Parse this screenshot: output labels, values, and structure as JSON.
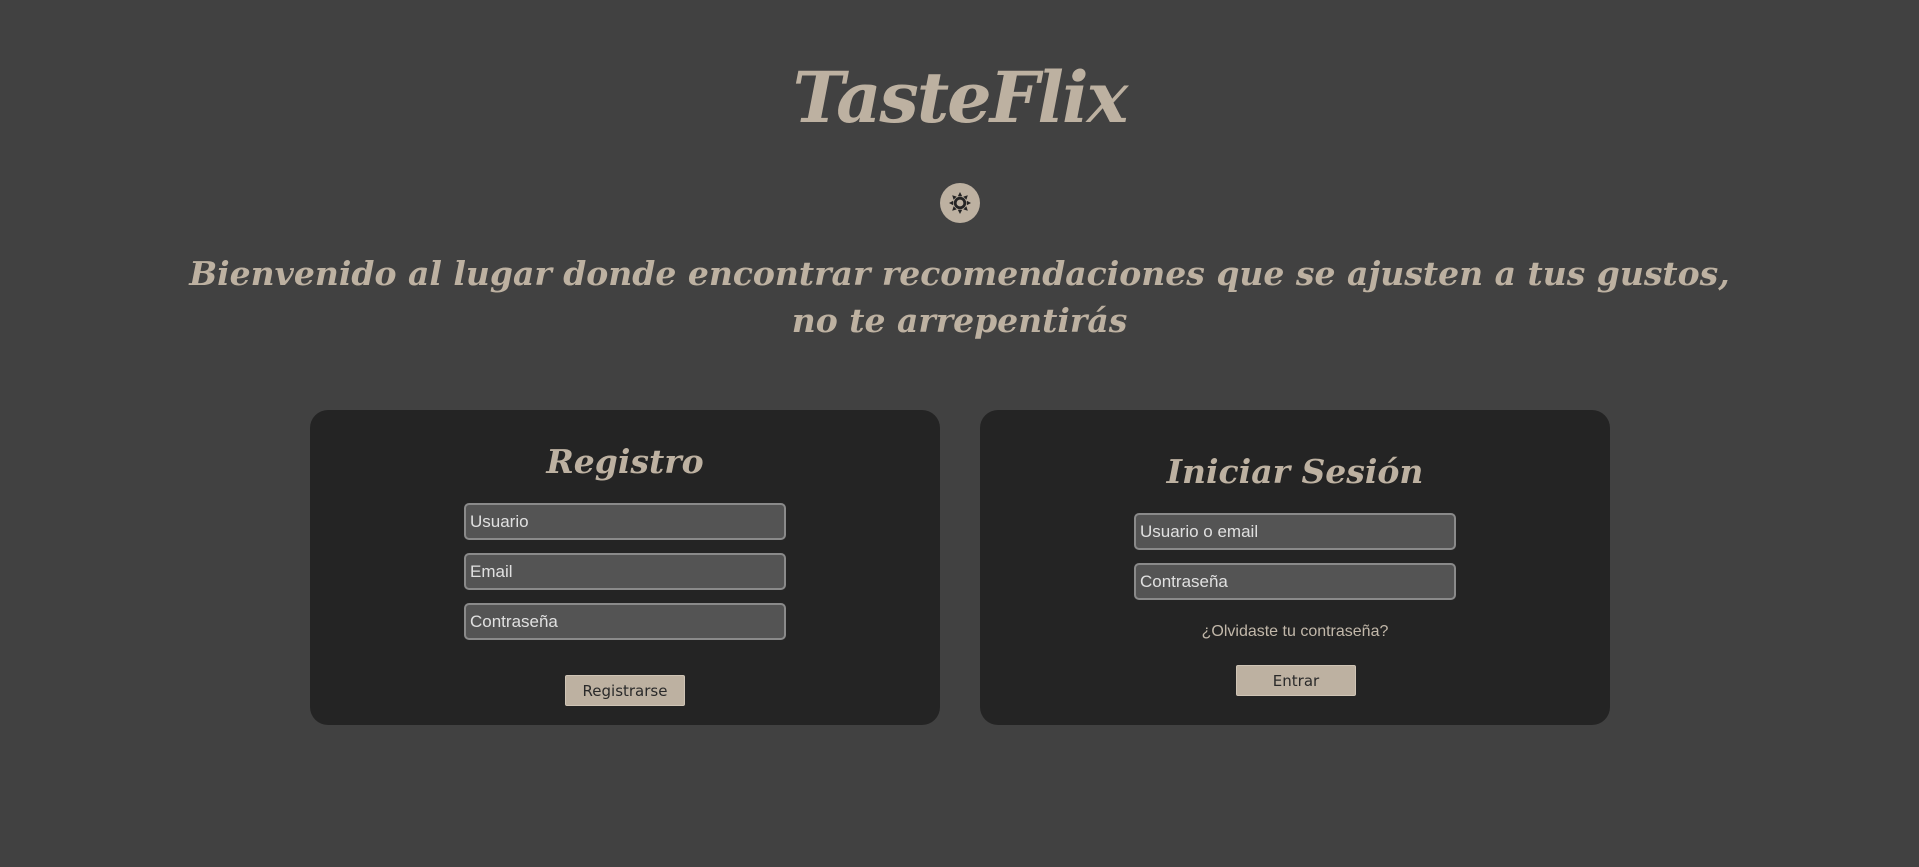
{
  "header": {
    "app_title": "TasteFlix",
    "theme_toggle_icon": "sun-icon",
    "welcome_line1": "Bienvenido al lugar donde encontrar recomendaciones que se ajusten a tus gustos,",
    "welcome_line2": "no te arrepentirás"
  },
  "register": {
    "title": "Registro",
    "username_placeholder": "Usuario",
    "email_placeholder": "Email",
    "password_placeholder": "Contraseña",
    "submit_label": "Registrarse"
  },
  "login": {
    "title": "Iniciar Sesión",
    "user_or_email_placeholder": "Usuario o email",
    "password_placeholder": "Contraseña",
    "forgot_password": "¿Olvidaste tu contraseña?",
    "submit_label": "Entrar"
  },
  "colors": {
    "background": "#414141",
    "card": "#242424",
    "accent": "#bdb1a1",
    "input_bg": "#545454"
  }
}
